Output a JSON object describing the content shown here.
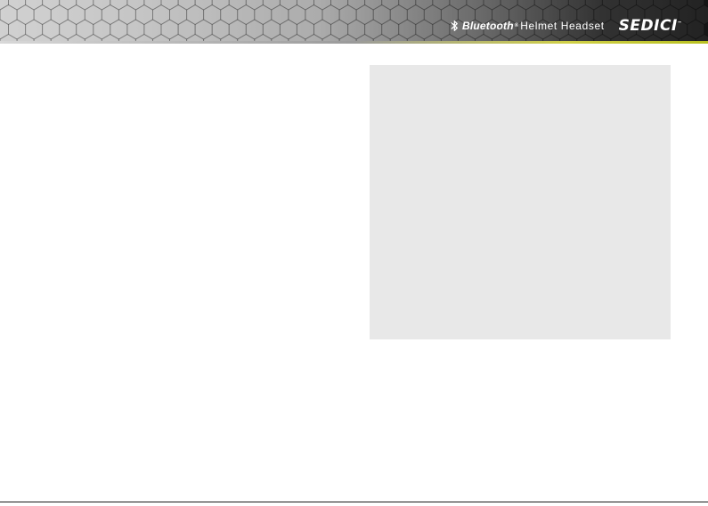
{
  "header": {
    "bluetooth_word": "Bluetooth",
    "registered_mark": "®",
    "product_name": "Helmet Headset",
    "logo_text": "SEDICI",
    "logo_tm": "™",
    "bluetooth_icon": "bluetooth-icon"
  },
  "colors": {
    "panel_background": "#e8e8e8",
    "header_dark": "#151515",
    "header_light": "#cfcfcf",
    "accent_yellow": "#c8c830",
    "text_on_header": "#ffffff"
  }
}
